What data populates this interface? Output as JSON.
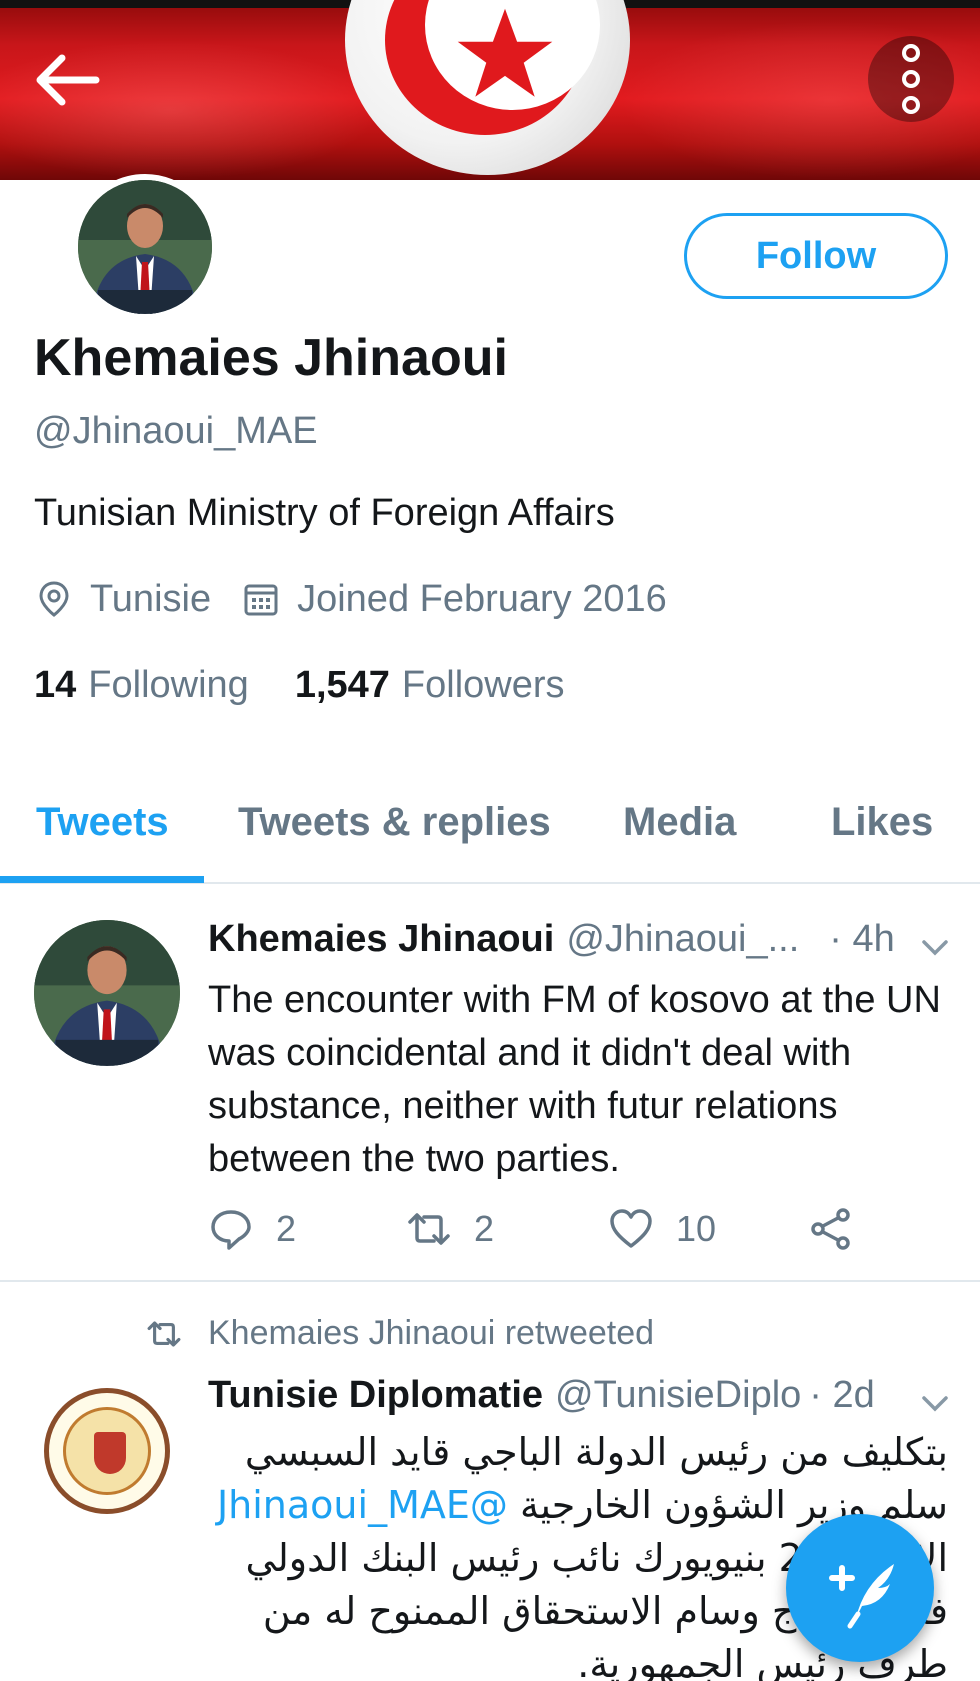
{
  "header": {
    "back_icon": "arrow-left-icon",
    "more_icon": "more-vertical-icon",
    "banner_colors": {
      "red": "#e21b1f",
      "white": "#ffffff"
    }
  },
  "profile": {
    "name": "Khemaies Jhinaoui",
    "handle": "@Jhinaoui_MAE",
    "bio": "Tunisian Ministry of Foreign Affairs",
    "location": "Tunisie",
    "joined": "Joined February 2016",
    "following_count": "14",
    "following_label": "Following",
    "followers_count": "1,547",
    "followers_label": "Followers",
    "follow_button": "Follow"
  },
  "tabs": [
    {
      "label": "Tweets",
      "active": true
    },
    {
      "label": "Tweets & replies",
      "active": false
    },
    {
      "label": "Media",
      "active": false
    },
    {
      "label": "Likes",
      "active": false
    }
  ],
  "tweets": [
    {
      "name": "Khemaies Jhinaoui",
      "handle": "@Jhinaoui_...",
      "time": "· 4h",
      "text": "The encounter with FM of kosovo at the UN was coincidental and it didn't deal with substance, neither with futur relations between the two parties.",
      "replies": "2",
      "retweets": "2",
      "likes": "10"
    },
    {
      "retweeted_by": "Khemaies Jhinaoui retweeted",
      "name": "Tunisie Diplomatie",
      "handle": "@TunisieDiplo",
      "time": "· 2d",
      "text_part1": "بتكليف من رئيس الدولة الباجي قايد السبسي سلم وزير الشؤون الخارجية",
      "mention": "@Jhinaoui_MAE",
      "text_part2": "الاربعاء 25 بنيويورك نائب رئيس البنك الدولي فريد بالحاج وسام الاستحقاق الممنوح له من طرف رئيس الجمهورية."
    }
  ],
  "accent_color": "#1da1f2",
  "compose_icon": "compose-tweet-icon"
}
